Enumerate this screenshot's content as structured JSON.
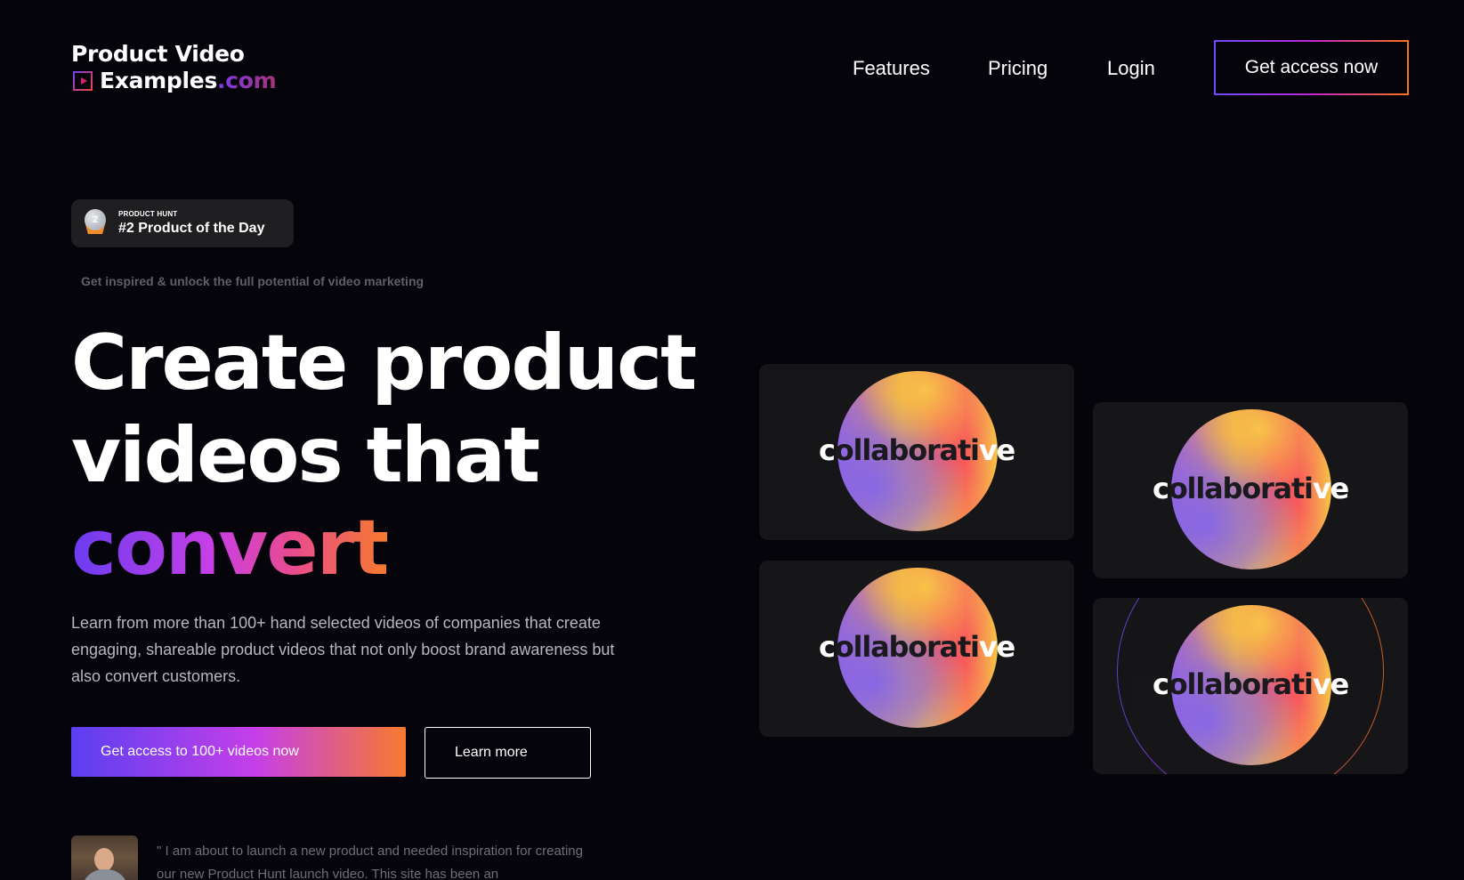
{
  "brand": {
    "line1": "Product Video",
    "line2": "Examples",
    "tld": ".com"
  },
  "nav": {
    "features": "Features",
    "pricing": "Pricing",
    "login": "Login",
    "cta": "Get access now"
  },
  "badge": {
    "medal_number": "2",
    "kicker": "PRODUCT HUNT",
    "title": "#2 Product of the Day"
  },
  "hero": {
    "tagline": "Get inspired & unlock the full potential of video marketing",
    "title_line1": "Create product",
    "title_line2": "videos that",
    "title_accent": "convert",
    "description": "Learn from more than 100+ hand selected videos of companies that create engaging, shareable product videos that not only boost brand awareness but also convert customers.",
    "primary_button": "Get access to 100+ videos now",
    "secondary_button": "Learn more"
  },
  "testimonial": {
    "quote": "\"  I am about to launch a new product and needed inspiration for creating our new Product Hunt launch video. This site has been an"
  },
  "video_cards": [
    {
      "word_prefix": "c",
      "word_middle": "ollaborati",
      "word_suffix": "ve"
    },
    {
      "word_prefix": "c",
      "word_middle": "ollaborati",
      "word_suffix": "ve"
    },
    {
      "word_prefix": "c",
      "word_middle": "ollaborati",
      "word_suffix": "ve"
    },
    {
      "word_prefix": "c",
      "word_middle": "ollaborati",
      "word_suffix": "ve"
    }
  ],
  "colors": {
    "background": "#05040a",
    "gradient_start": "#6a3cf0",
    "gradient_mid": "#c83fe6",
    "gradient_end": "#f77a2e",
    "card_background": "#161618"
  }
}
